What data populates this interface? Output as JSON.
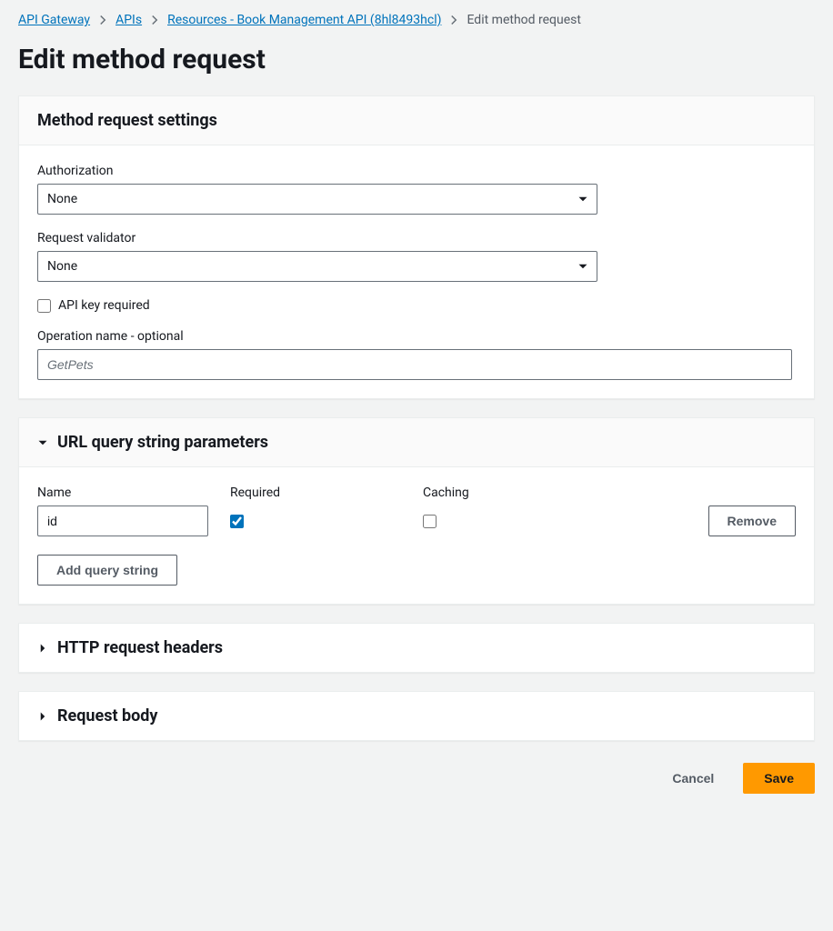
{
  "breadcrumb": {
    "items": [
      {
        "label": "API Gateway",
        "link": true
      },
      {
        "label": "APIs",
        "link": true
      },
      {
        "label": "Resources - Book Management API (8hl8493hcl)",
        "link": true
      },
      {
        "label": "Edit method request",
        "link": false
      }
    ]
  },
  "page": {
    "title": "Edit method request"
  },
  "settings": {
    "panel_title": "Method request settings",
    "authorization": {
      "label": "Authorization",
      "value": "None"
    },
    "validator": {
      "label": "Request validator",
      "value": "None"
    },
    "api_key": {
      "label": "API key required",
      "checked": false
    },
    "operation_name": {
      "label": "Operation name - optional",
      "placeholder": "GetPets",
      "value": ""
    }
  },
  "query_params": {
    "panel_title": "URL query string parameters",
    "headers": {
      "name": "Name",
      "required": "Required",
      "caching": "Caching"
    },
    "rows": [
      {
        "name": "id",
        "required": true,
        "caching": false
      }
    ],
    "remove_label": "Remove",
    "add_label": "Add query string"
  },
  "http_headers": {
    "panel_title": "HTTP request headers"
  },
  "request_body": {
    "panel_title": "Request body"
  },
  "actions": {
    "cancel": "Cancel",
    "save": "Save"
  }
}
